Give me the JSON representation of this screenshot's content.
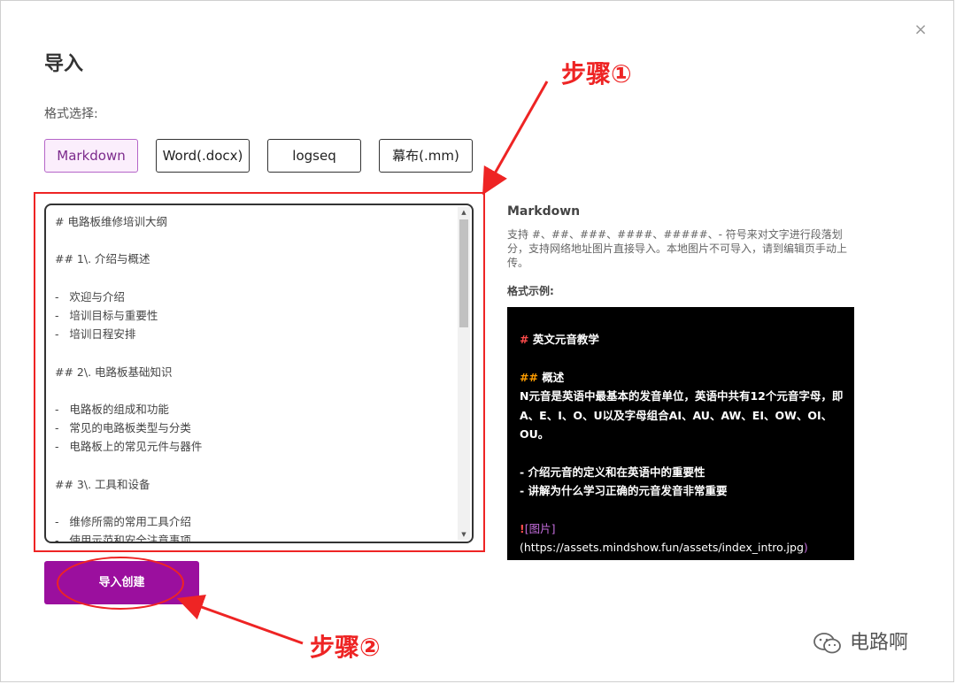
{
  "dialog": {
    "title": "导入",
    "close_glyph": "×",
    "format_label": "格式选择:"
  },
  "formats": [
    {
      "label": "Markdown",
      "active": true
    },
    {
      "label": "Word(.docx)",
      "active": false
    },
    {
      "label": "logseq",
      "active": false
    },
    {
      "label": "幕布(.mm)",
      "active": false
    }
  ],
  "editor": {
    "lines": [
      "# 电路板维修培训大纲",
      "",
      "## 1\\. 介绍与概述",
      "",
      "-   欢迎与介绍",
      "-   培训目标与重要性",
      "-   培训日程安排",
      "",
      "## 2\\. 电路板基础知识",
      "",
      "-   电路板的组成和功能",
      "-   常见的电路板类型与分类",
      "-   电路板上的常见元件与器件",
      "",
      "## 3\\. 工具和设备",
      "",
      "-   维修所需的常用工具介绍",
      "-   使用示范和安全注意事项"
    ]
  },
  "submit_label": "导入创建",
  "info": {
    "title": "Markdown",
    "description": "支持 #、##、###、####、#####、- 符号来对文字进行段落划分，支持网络地址图片直接导入。本地图片不可导入，请到编辑页手动上传。",
    "example_label": "格式示例:"
  },
  "example": {
    "h1_mark": "#",
    "h1_text": " 英文元音教学",
    "h2_mark": "##",
    "h2_text": " 概述",
    "para": " N元音是英语中最基本的发音单位，英语中共有12个元音字母，即A、E、I、O、U以及字母组合AI、AU、AW、EI、OW、OI、OU。",
    "bullet1": "- 介绍元音的定义和在英语中的重要性",
    "bullet2": "- 讲解为什么学习正确的元音发音非常重要",
    "img_mark": "!",
    "img_alt": "[图片]",
    "img_url": "(https://assets.mindshow.fun/assets/index_intro.jpg",
    "img_close": ")"
  },
  "annotations": {
    "step1": "步骤①",
    "step2": "步骤②",
    "color": "#ee2424"
  },
  "watermark": "电路啊"
}
